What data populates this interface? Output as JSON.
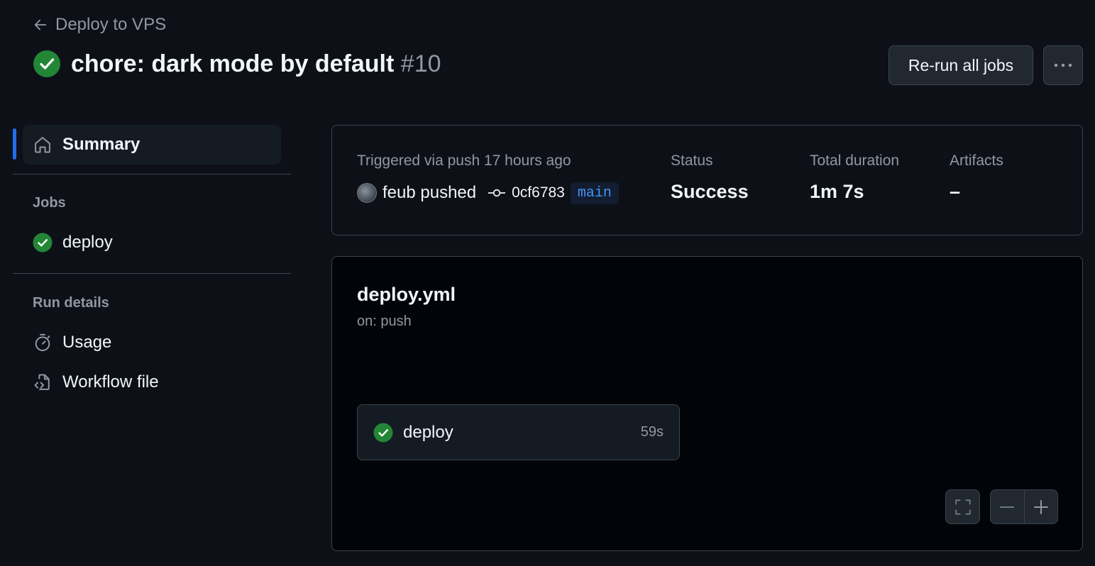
{
  "header": {
    "back_label": "Deploy to VPS",
    "title": "chore: dark mode by default",
    "run_number": "#10",
    "rerun_label": "Re-run all jobs"
  },
  "sidebar": {
    "summary_label": "Summary",
    "jobs_heading": "Jobs",
    "jobs": [
      {
        "label": "deploy",
        "status": "success"
      }
    ],
    "run_details_heading": "Run details",
    "details": [
      {
        "label": "Usage",
        "icon": "stopwatch-icon"
      },
      {
        "label": "Workflow file",
        "icon": "file-code-icon"
      }
    ]
  },
  "summary": {
    "trigger_label": "Triggered via push 17 hours ago",
    "actor_text": "feub pushed",
    "commit_sha": "0cf6783",
    "branch": "main",
    "status_label": "Status",
    "status_value": "Success",
    "duration_label": "Total duration",
    "duration_value": "1m 7s",
    "artifacts_label": "Artifacts",
    "artifacts_value": "–"
  },
  "graph": {
    "workflow_file": "deploy.yml",
    "trigger": "on: push",
    "jobs": [
      {
        "name": "deploy",
        "duration": "59s",
        "status": "success"
      }
    ]
  },
  "colors": {
    "background": "#0d1117",
    "success": "#238636",
    "accent": "#1f6feb",
    "link": "#4493f8",
    "border": "#3d444d"
  }
}
